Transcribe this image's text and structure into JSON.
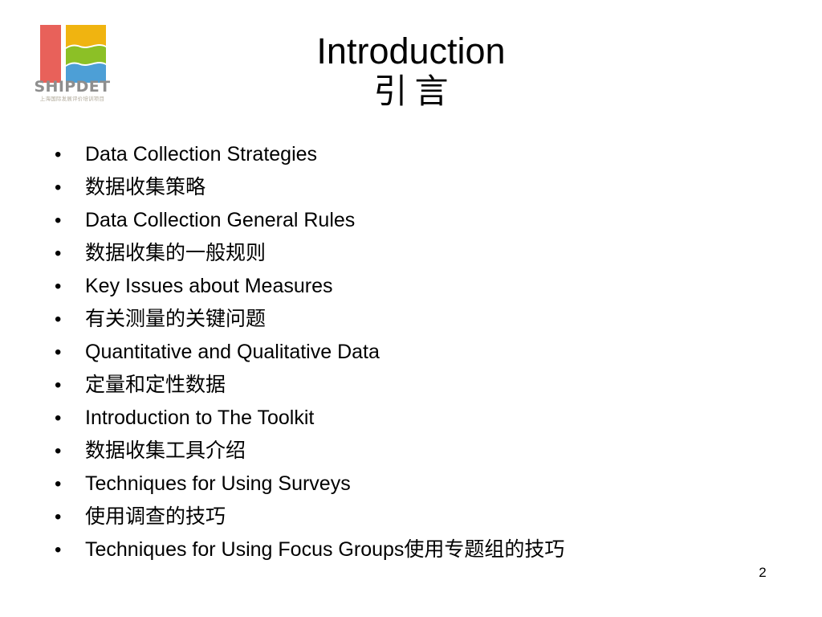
{
  "slide": {
    "title_en": "Introduction",
    "title_cn": "引言",
    "page_number": "2"
  },
  "logo": {
    "wordmark": "SHIPDET",
    "subtitle_cn": "上海国际发展评价培训项目",
    "colors": {
      "bar_red": "#e8615a",
      "wave_yellow": "#f0b410",
      "wave_green": "#8cc026",
      "wave_blue": "#4d9fd6",
      "wordmark_gray": "#8e8e8e"
    }
  },
  "bullets": {
    "marker": "•",
    "items": [
      {
        "text": "Data Collection Strategies",
        "lang": "en"
      },
      {
        "text": "数据收集策略",
        "lang": "cn"
      },
      {
        "text": "Data Collection General Rules",
        "lang": "en"
      },
      {
        "text": "数据收集的一般规则",
        "lang": "cn"
      },
      {
        "text": "Key Issues about Measures",
        "lang": "en"
      },
      {
        "text": "有关测量的关键问题",
        "lang": "cn"
      },
      {
        "text": "Quantitative and Qualitative Data",
        "lang": "en"
      },
      {
        "text": "定量和定性数据",
        "lang": "cn"
      },
      {
        "text": "Introduction to The Toolkit",
        "lang": "en"
      },
      {
        "text": "数据收集工具介绍",
        "lang": "cn"
      },
      {
        "text": "Techniques for Using Surveys",
        "lang": "en"
      },
      {
        "text": "使用调查的技巧",
        "lang": "cn"
      },
      {
        "text": "Techniques for Using Focus Groups使用专题组的技巧",
        "lang": "mixed"
      }
    ]
  }
}
